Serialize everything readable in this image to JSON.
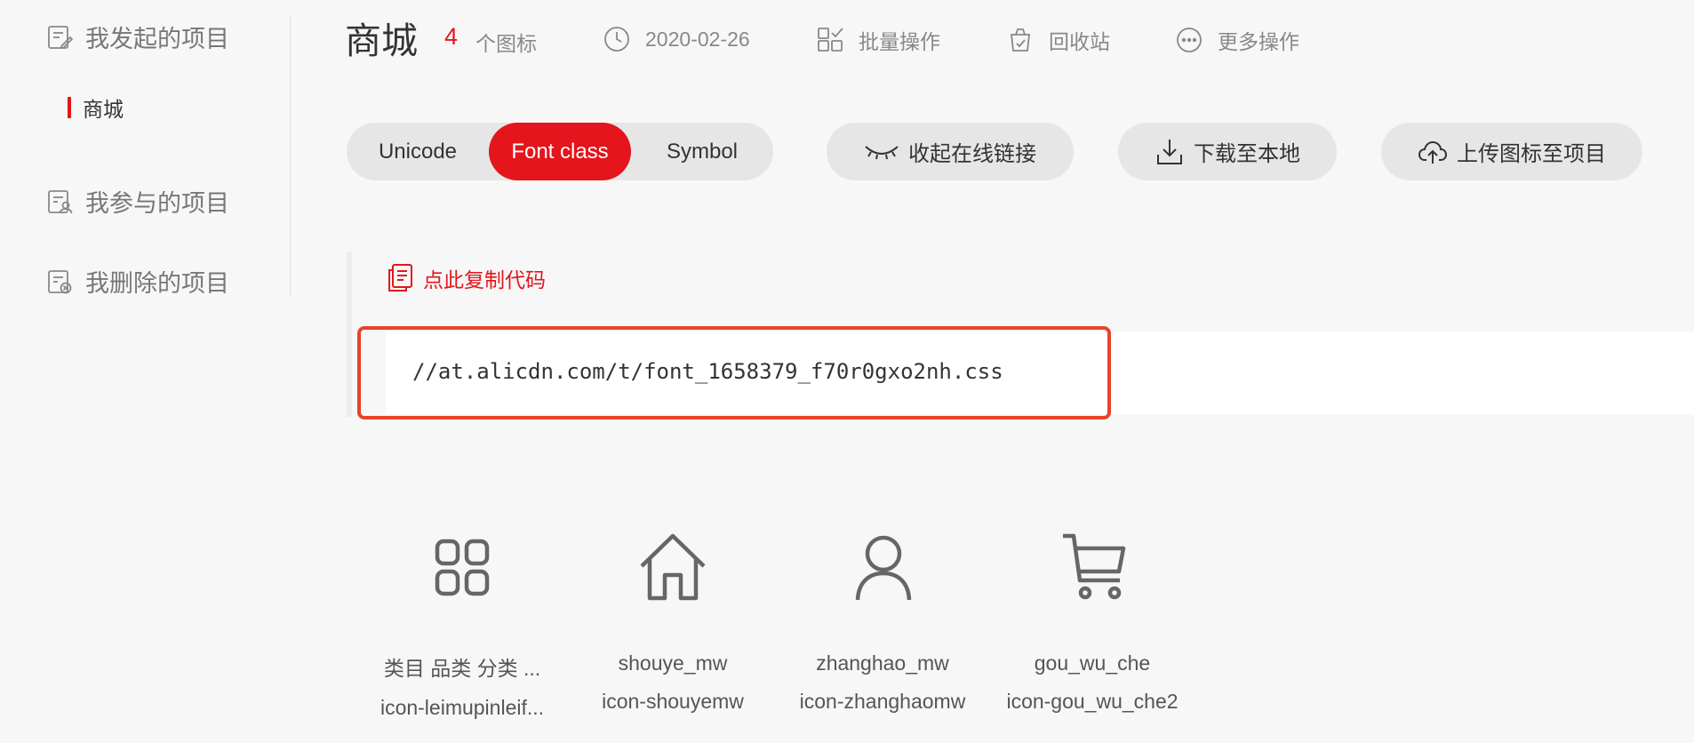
{
  "sidebar": {
    "items": [
      {
        "label": "我发起的项目",
        "icon": "edit-doc-icon"
      },
      {
        "label": "我参与的项目",
        "icon": "user-doc-icon"
      },
      {
        "label": "我删除的项目",
        "icon": "delete-doc-icon"
      }
    ],
    "active_project": "商城"
  },
  "header": {
    "title": "商城",
    "icon_count": "4",
    "icon_count_unit": "个图标",
    "date": "2020-02-26",
    "batch_label": "批量操作",
    "recycle_label": "回收站",
    "more_label": "更多操作"
  },
  "toolbar": {
    "tabs": [
      "Unicode",
      "Font class",
      "Symbol"
    ],
    "active_tab": "Font class",
    "collapse_label": "收起在线链接",
    "download_label": "下载至本地",
    "upload_label": "上传图标至项目"
  },
  "code": {
    "copy_label": "点此复制代码",
    "url": "//at.alicdn.com/t/font_1658379_f70r0gxo2nh.css"
  },
  "icons": [
    {
      "name": "类目 品类 分类 ...",
      "class": "icon-leimupinleif...",
      "glyph": "category-icon"
    },
    {
      "name": "shouye_mw",
      "class": "icon-shouyemw",
      "glyph": "home-icon"
    },
    {
      "name": "zhanghao_mw",
      "class": "icon-zhanghaomw",
      "glyph": "user-icon"
    },
    {
      "name": "gou_wu_che",
      "class": "icon-gou_wu_che2",
      "glyph": "cart-icon"
    }
  ],
  "colors": {
    "accent": "#e4151c",
    "highlight_border": "#e8432a",
    "background": "#f7f7f7"
  }
}
